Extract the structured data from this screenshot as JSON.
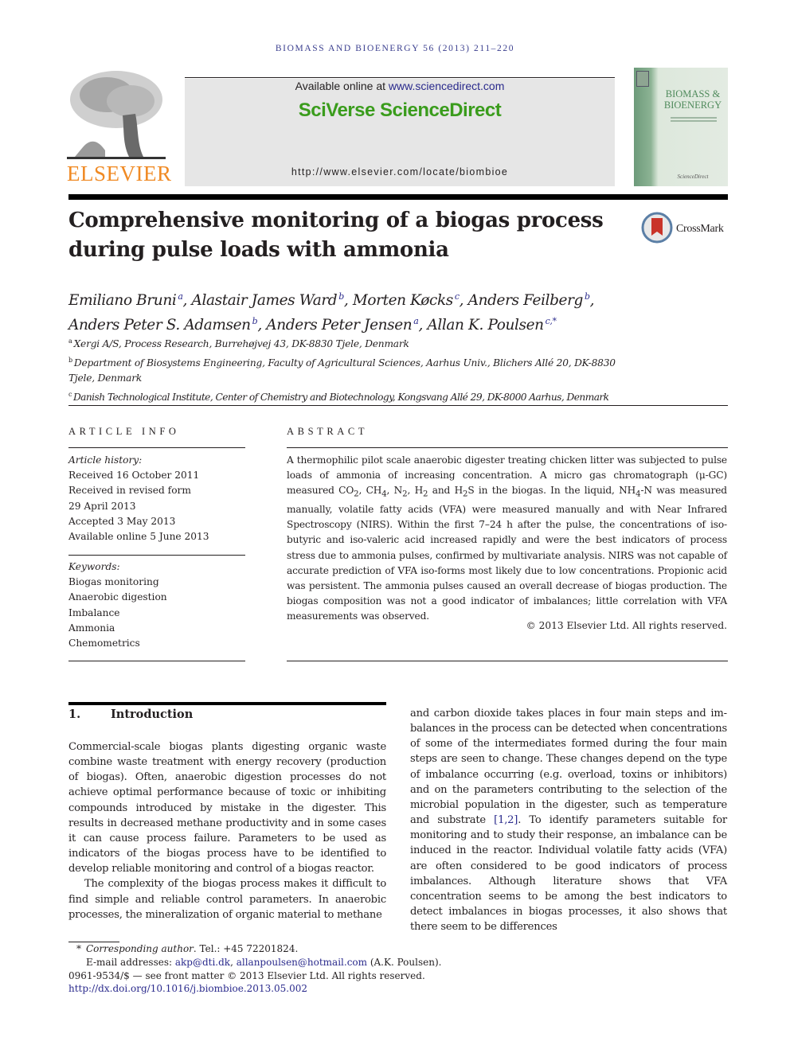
{
  "journal_ref": "Biomass and Bioenergy 56 (2013) 211–220",
  "header": {
    "publisher_logo_text": "ELSEVIER",
    "available_prefix": "Available online at ",
    "available_link": "www.sciencedirect.com",
    "brand": "SciVerse ScienceDirect",
    "journal_url": "http://www.elsevier.com/locate/biombioe",
    "cover_title_line1": "BIOMASS &",
    "cover_title_line2": "BIOENERGY",
    "cover_footer": "ScienceDirect"
  },
  "crossmark_label": "CrossMark",
  "title": "Comprehensive monitoring of a biogas process during pulse loads with ammonia",
  "authors": [
    {
      "name": "Emiliano Bruni",
      "aff": "a",
      "sep": ", "
    },
    {
      "name": "Alastair James Ward",
      "aff": "b",
      "sep": ", "
    },
    {
      "name": "Morten Køcks",
      "aff": "c",
      "sep": ", "
    },
    {
      "name": "Anders Feilberg",
      "aff": "b",
      "sep": ","
    },
    {
      "name": "Anders Peter S. Adamsen",
      "aff": "b",
      "sep": ", "
    },
    {
      "name": "Anders Peter Jensen",
      "aff": "a",
      "sep": ", "
    },
    {
      "name": "Allan K. Poulsen",
      "aff": "c,*",
      "sep": ""
    }
  ],
  "affiliations": [
    {
      "key": "a",
      "text": "Xergi A/S, Process Research, Burrehøjvej 43, DK-8830 Tjele, Denmark"
    },
    {
      "key": "b",
      "text": "Department of Biosystems Engineering, Faculty of Agricultural Sciences, Aarhus Univ., Blichers Allé 20, DK-8830 Tjele, Denmark"
    },
    {
      "key": "c",
      "text": "Danish Technological Institute, Center of Chemistry and Biotechnology, Kongsvang Allé 29, DK-8000 Aarhus, Denmark"
    }
  ],
  "article_info": {
    "heading": "ARTICLE INFO",
    "history_label": "Article history:",
    "history": [
      "Received 16 October 2011",
      "Received in revised form",
      "29 April 2013",
      "Accepted 3 May 2013",
      "Available online 5 June 2013"
    ],
    "keywords_label": "Keywords:",
    "keywords": [
      "Biogas monitoring",
      "Anaerobic digestion",
      "Imbalance",
      "Ammonia",
      "Chemometrics"
    ]
  },
  "abstract": {
    "heading": "ABSTRACT",
    "text_1": "A thermophilic pilot scale anaerobic digester treating chicken litter was subjected to pulse loads of ammonia of increasing concentration. A micro gas chromatograph (μ-GC) measured CO",
    "text_2": ", CH",
    "text_3": ", N",
    "text_4": ", H",
    "text_5": " and H",
    "text_6": "S in the biogas. In the liquid, NH",
    "text_7": "-N was measured manually, volatile fatty acids (VFA) were measured manually and with Near Infrared Spectroscopy (NIRS). Within the first 7–24 h after the pulse, the concentrations of iso-butyric and iso-valeric acid increased rapidly and were the best indicators of process stress due to ammonia pulses, confirmed by multivariate analysis. NIRS was not capable of accurate prediction of VFA iso-forms most likely due to low concentrations. Propionic acid was persistent. The ammonia pulses caused an overall decrease of biogas production. The biogas composition was not a good indicator of imbalances; little correlation with VFA measurements was observed.",
    "sub_2": "2",
    "sub_4": "4",
    "copyright": "© 2013 Elsevier Ltd. All rights reserved."
  },
  "introduction": {
    "number": "1.",
    "heading": "Introduction",
    "para1": "Commercial-scale biogas plants digesting organic waste combine waste treatment with energy recovery (production of biogas). Often, anaerobic digestion processes do not achieve optimal performance because of toxic or inhibiting com­pounds introduced by mistake in the digester. This results in decreased methane productivity and in some cases it can cause process failure. Parameters to be used as indicators of the biogas process have to be identified to develop reliable monitoring and control of a biogas reactor.",
    "para2": "The complexity of the biogas process makes it difficult to find simple and reliable control parameters. In anaerobic processes, the mineralization of organic material to methane",
    "right_1": "and carbon dioxide takes places in four main steps and im­balances in the process can be detected when concentrations of some of the intermediates formed during the four main steps are seen to change. These changes depend on the type of imbalance occurring (e.g. overload, toxins or inhibitors) and on the parameters contributing to the selection of the micro­bial population in the digester, such as temperature and substrate ",
    "right_cite": "[1,2]",
    "right_2": ". To identify parameters suitable for monitoring and to study their response, an imbalance can be induced in the reactor. Individual volatile fatty acids (VFA) are often considered to be good indicators of process imbalances. Although literature shows that VFA concentration seems to be among the best indicators to detect imbalances in biogas processes, it also shows that there seem to be differences"
  },
  "footnotes": {
    "star": "*",
    "corr_label": "Corresponding author",
    "corr_tel": ". Tel.: +45 72201824.",
    "email_label": "E-mail addresses: ",
    "email1": "akp@dti.dk",
    "email_sep": ", ",
    "email2": "allanpoulsen@hotmail.com",
    "email_owner": " (A.K. Poulsen).",
    "issn_line": "0961-9534/$ — see front matter © 2013 Elsevier Ltd. All rights reserved.",
    "doi": "http://dx.doi.org/10.1016/j.biombioe.2013.05.002"
  },
  "colors": {
    "link": "#2a2a8c",
    "brand_green": "#3a9c1c",
    "elsevier_orange": "#f08a24",
    "journal_ref": "#3b3f8f"
  }
}
